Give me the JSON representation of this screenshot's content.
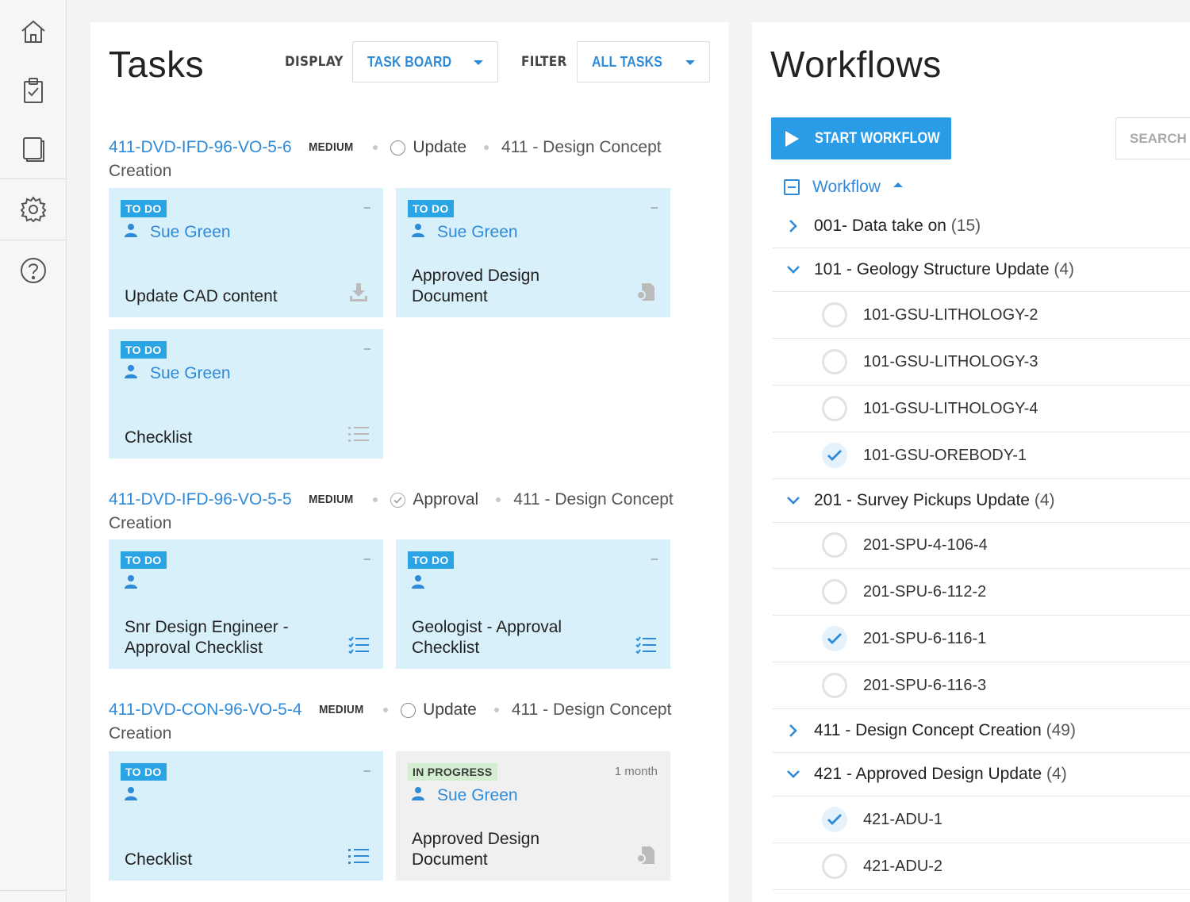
{
  "tasks": {
    "title": "Tasks",
    "display_label": "DISPLAY",
    "display_value": "TASK BOARD",
    "filter_label": "FILTER",
    "filter_value": "ALL TASKS",
    "groups": [
      {
        "code": "411-DVD-IFD-96-VO-5-6",
        "priority": "MEDIUM",
        "type": "Update",
        "workflow_a": "411 - Design Concept",
        "workflow_b": "Creation",
        "cards": [
          {
            "status": "TO DO",
            "meta": "–",
            "assignee": "Sue Green",
            "title": "Update CAD content",
            "icon": "download-icon"
          },
          {
            "status": "TO DO",
            "meta": "–",
            "assignee": "Sue Green",
            "title": "Approved Design Document",
            "icon": "document-icon"
          },
          {
            "status": "TO DO",
            "meta": "–",
            "assignee": "Sue Green",
            "title": "Checklist",
            "icon": "list-icon"
          }
        ]
      },
      {
        "code": "411-DVD-IFD-96-VO-5-5",
        "priority": "MEDIUM",
        "type": "Approval",
        "workflow_a": "411 - Design Concept",
        "workflow_b": "Creation",
        "cards": [
          {
            "status": "TO DO",
            "meta": "–",
            "assignee": "",
            "title": "Snr Design Engineer - Approval Checklist",
            "icon": "checklist-icon"
          },
          {
            "status": "TO DO",
            "meta": "–",
            "assignee": "",
            "title": "Geologist - Approval Checklist",
            "icon": "checklist-icon"
          }
        ]
      },
      {
        "code": "411-DVD-CON-96-VO-5-4",
        "priority": "MEDIUM",
        "type": "Update",
        "workflow_a": "411 - Design Concept",
        "workflow_b": "Creation",
        "cards": [
          {
            "status": "TO DO",
            "meta": "–",
            "assignee": "",
            "title": "Checklist",
            "icon": "list-icon"
          },
          {
            "status": "IN PROGRESS",
            "meta": "1 month",
            "assignee": "Sue Green",
            "title": "Approved Design Document",
            "icon": "document-icon"
          }
        ]
      }
    ]
  },
  "workflows": {
    "title": "Workflows",
    "start_label": "START WORKFLOW",
    "search_placeholder": "SEARCH",
    "header": "Workflow",
    "rows": [
      {
        "kind": "group",
        "expanded": false,
        "label": "001- Data take on",
        "count": "(15)"
      },
      {
        "kind": "group",
        "expanded": true,
        "label": "101 - Geology Structure Update",
        "count": "(4)"
      },
      {
        "kind": "item",
        "done": false,
        "label": "101-GSU-LITHOLOGY-2"
      },
      {
        "kind": "item",
        "done": false,
        "label": "101-GSU-LITHOLOGY-3"
      },
      {
        "kind": "item",
        "done": false,
        "label": "101-GSU-LITHOLOGY-4"
      },
      {
        "kind": "item",
        "done": true,
        "label": "101-GSU-OREBODY-1"
      },
      {
        "kind": "group",
        "expanded": true,
        "label": "201 - Survey Pickups Update",
        "count": "(4)"
      },
      {
        "kind": "item",
        "done": false,
        "label": "201-SPU-4-106-4"
      },
      {
        "kind": "item",
        "done": false,
        "label": "201-SPU-6-112-2"
      },
      {
        "kind": "item",
        "done": true,
        "label": "201-SPU-6-116-1"
      },
      {
        "kind": "item",
        "done": false,
        "label": "201-SPU-6-116-3"
      },
      {
        "kind": "group",
        "expanded": false,
        "label": "411 - Design Concept Creation",
        "count": "(49)"
      },
      {
        "kind": "group",
        "expanded": true,
        "label": "421 - Approved Design Update",
        "count": "(4)"
      },
      {
        "kind": "item",
        "done": true,
        "label": "421-ADU-1"
      },
      {
        "kind": "item",
        "done": false,
        "label": "421-ADU-2"
      }
    ]
  },
  "colors": {
    "accent": "#2f8ad8",
    "card_bg": "#d7f0fa",
    "badge_todo": "#2aa4e4",
    "badge_progress": "#d3eed1"
  }
}
